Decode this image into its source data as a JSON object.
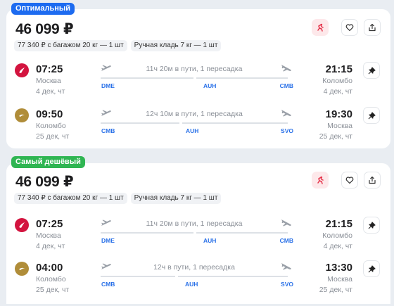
{
  "cards": [
    {
      "badge": "Оптимальный",
      "price": "46 099 ₽",
      "tags": [
        "77 340 ₽ с багажом 20 кг — 1 шт",
        "Ручная кладь 7 кг — 1 шт"
      ],
      "segments": [
        {
          "airline_logo": "red-bird-logo",
          "dep_time": "07:25",
          "dep_city": "Москва",
          "dep_date": "4 дек, чт",
          "duration": "11ч 20м в пути, 1 пересадка",
          "codes": [
            "DME",
            "AUH",
            "CMB"
          ],
          "arr_time": "21:15",
          "arr_city": "Коломбо",
          "arr_date": "4 дек, чт"
        },
        {
          "airline_logo": "gold-etihad-logo",
          "dep_time": "09:50",
          "dep_city": "Коломбо",
          "dep_date": "25 дек, чт",
          "duration": "12ч 10м в пути, 1 пересадка",
          "codes": [
            "CMB",
            "AUH",
            "SVO"
          ],
          "arr_time": "19:30",
          "arr_city": "Москва",
          "arr_date": "25 дек, чт"
        }
      ]
    },
    {
      "badge": "Самый дешёвый",
      "price": "46 099 ₽",
      "tags": [
        "77 340 ₽ с багажом 20 кг — 1 шт",
        "Ручная кладь 7 кг — 1 шт"
      ],
      "segments": [
        {
          "airline_logo": "red-bird-logo",
          "dep_time": "07:25",
          "dep_city": "Москва",
          "dep_date": "4 дек, чт",
          "duration": "11ч 20м в пути, 1 пересадка",
          "codes": [
            "DME",
            "AUH",
            "CMB"
          ],
          "arr_time": "21:15",
          "arr_city": "Коломбо",
          "arr_date": "4 дек, чт"
        },
        {
          "airline_logo": "gold-etihad-logo",
          "dep_time": "04:00",
          "dep_city": "Коломбо",
          "dep_date": "25 дек, чт",
          "duration": "12ч в пути, 1 пересадка",
          "codes": [
            "CMB",
            "AUH",
            "SVO"
          ],
          "arr_time": "13:30",
          "arr_city": "Москва",
          "arr_date": "25 дек, чт"
        }
      ]
    }
  ],
  "icons": {
    "hot": "fire-icon",
    "favorite": "heart-icon",
    "share": "share-icon",
    "pin": "pin-icon"
  },
  "colors": {
    "accent": "#2a71e8",
    "badge_optimal": "#1d6bf0",
    "badge_cheapest": "#2fb552",
    "hot_bg": "#fde8ea"
  }
}
